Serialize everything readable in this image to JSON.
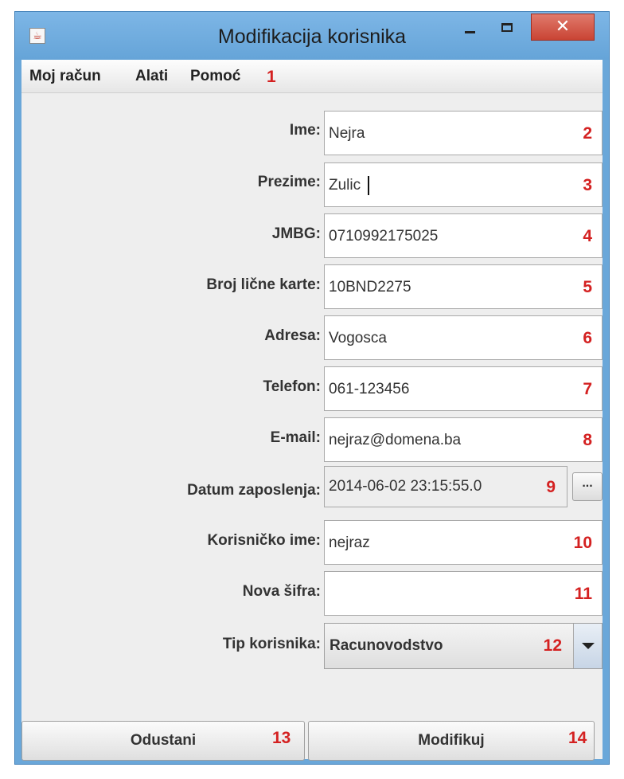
{
  "window": {
    "title": "Modifikacija korisnika",
    "close_glyph": "✕"
  },
  "menu": {
    "items": [
      "Moj račun",
      "Alati",
      "Pomoć"
    ],
    "annotation": "1"
  },
  "form": {
    "fields": [
      {
        "label": "Ime:",
        "value": "Nejra",
        "annotation": "2"
      },
      {
        "label": "Prezime:",
        "value": "Zulic",
        "annotation": "3"
      },
      {
        "label": "JMBG:",
        "value": "0710992175025",
        "annotation": "4"
      },
      {
        "label": "Broj lične karte:",
        "value": "10BND2275",
        "annotation": "5"
      },
      {
        "label": "Adresa:",
        "value": "Vogosca",
        "annotation": "6"
      },
      {
        "label": "Telefon:",
        "value": "061-123456",
        "annotation": "7"
      },
      {
        "label": "E-mail:",
        "value": "nejraz@domena.ba",
        "annotation": "8"
      },
      {
        "label": "Datum zaposlenja:",
        "value": "2014-06-02 23:15:55.0",
        "annotation": "9",
        "button_label": "..."
      },
      {
        "label": "Korisničko ime:",
        "value": "nejraz",
        "annotation": "10"
      },
      {
        "label": "Nova šifra:",
        "value": "",
        "annotation": "11"
      }
    ],
    "user_type": {
      "label": "Tip korisnika:",
      "value": "Racunovodstvo",
      "annotation": "12"
    }
  },
  "buttons": {
    "cancel": {
      "label": "Odustani",
      "annotation": "13"
    },
    "modify": {
      "label": "Modifikuj",
      "annotation": "14"
    }
  },
  "colors": {
    "annotation": "#d42121",
    "titlebar": "#6aa7d9",
    "close_button": "#c94434"
  },
  "icons": [
    "java-app-icon",
    "minimize-icon",
    "maximize-icon",
    "close-icon",
    "chevron-down-icon"
  ]
}
